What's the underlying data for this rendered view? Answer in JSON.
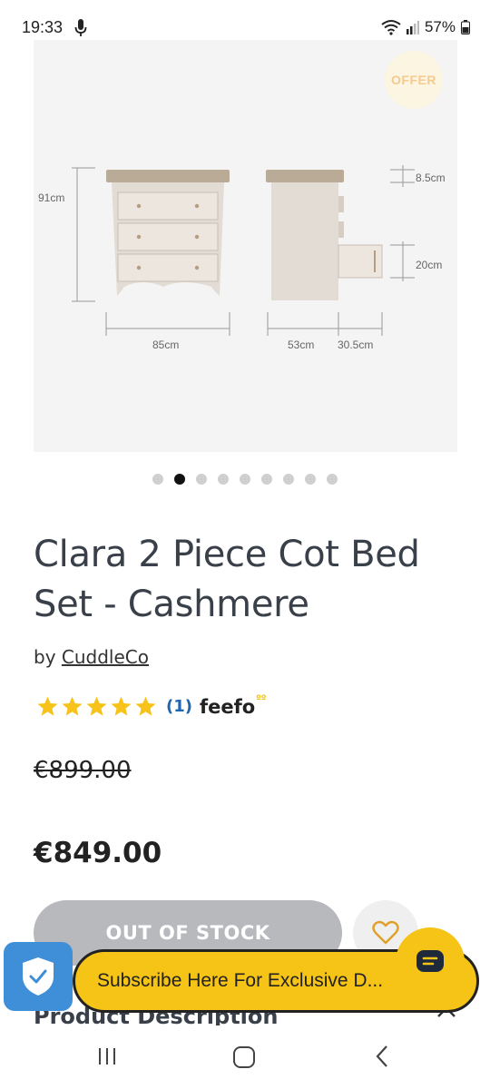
{
  "status_bar": {
    "time": "19:33",
    "battery": "57%",
    "icons": [
      "mic-icon",
      "wifi-icon",
      "signal-icon",
      "battery-icon"
    ]
  },
  "product_image": {
    "offer_badge": "OFFER",
    "dimensions": {
      "height": "91cm",
      "top_height": "8.5cm",
      "drawer_height": "20cm",
      "width": "85cm",
      "depth": "53cm",
      "drawer_depth": "30.5cm"
    }
  },
  "carousel": {
    "count": 9,
    "active_index": 1
  },
  "product": {
    "title": "Clara 2 Piece Cot Bed Set - Cashmere",
    "by_label": "by",
    "brand": "CuddleCo",
    "rating": {
      "stars": 5,
      "review_count": "(1)",
      "provider": "feefo",
      "provider_mark": "ºº"
    },
    "price_old": "€899.00",
    "price_new": "€849.00",
    "oos_label": "OUT OF STOCK"
  },
  "description": {
    "heading": "Product Description"
  },
  "subscribe": {
    "label": "Subscribe Here For Exclusive D..."
  },
  "colors": {
    "accent_yellow": "#f5c416",
    "shield_blue": "#3f8fd8",
    "star_yellow": "#f7c31a",
    "review_blue": "#1f66b0",
    "button_gray": "#b7b9bd"
  }
}
